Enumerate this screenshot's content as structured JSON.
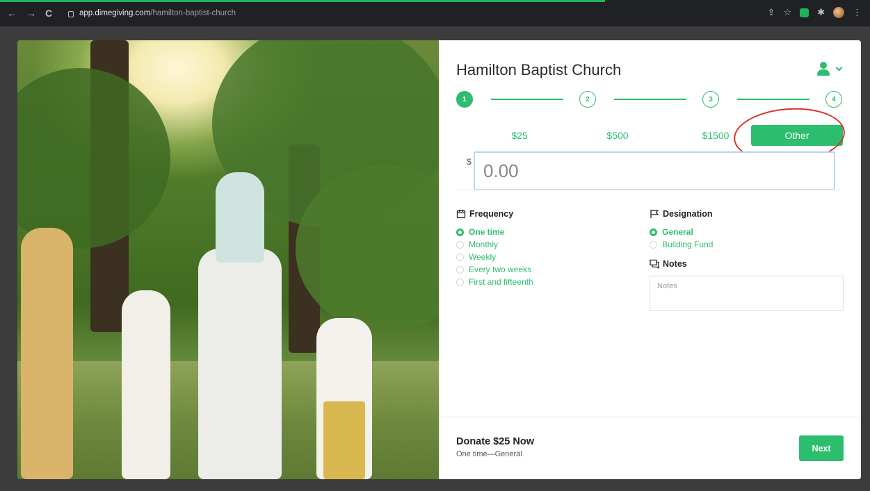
{
  "browser": {
    "url_host": "app.dimegiving.com",
    "url_path": "/hamilton-baptist-church",
    "back_glyph": "←",
    "forward_glyph": "→",
    "reload_glyph": "C",
    "share_glyph": "⇪",
    "star_glyph": "☆",
    "puzzle_glyph": "✱",
    "more_glyph": "⋮"
  },
  "header": {
    "title": "Hamilton Baptist Church"
  },
  "stepper": {
    "steps": [
      "1",
      "2",
      "3",
      "4"
    ],
    "active_index": 0
  },
  "amount_options": [
    {
      "label": "$25",
      "selected": false
    },
    {
      "label": "$500",
      "selected": false
    },
    {
      "label": "$1500",
      "selected": false
    },
    {
      "label": "Other",
      "selected": true
    }
  ],
  "amount_field": {
    "currency": "$",
    "placeholder": "0.00"
  },
  "frequency": {
    "heading": "Frequency",
    "options": [
      "One time",
      "Monthly",
      "Weekly",
      "Every two weeks",
      "First and fifteenth"
    ],
    "selected_index": 0
  },
  "designation": {
    "heading": "Designation",
    "options": [
      "General",
      "Building Fund"
    ],
    "selected_index": 0
  },
  "notes": {
    "heading": "Notes",
    "placeholder": "Notes"
  },
  "footer": {
    "donate_title": "Donate $25 Now",
    "donate_subtitle": "One time—General",
    "next_label": "Next"
  },
  "colors": {
    "accent": "#2dbd6e",
    "highlight_ring": "#d9342b"
  }
}
